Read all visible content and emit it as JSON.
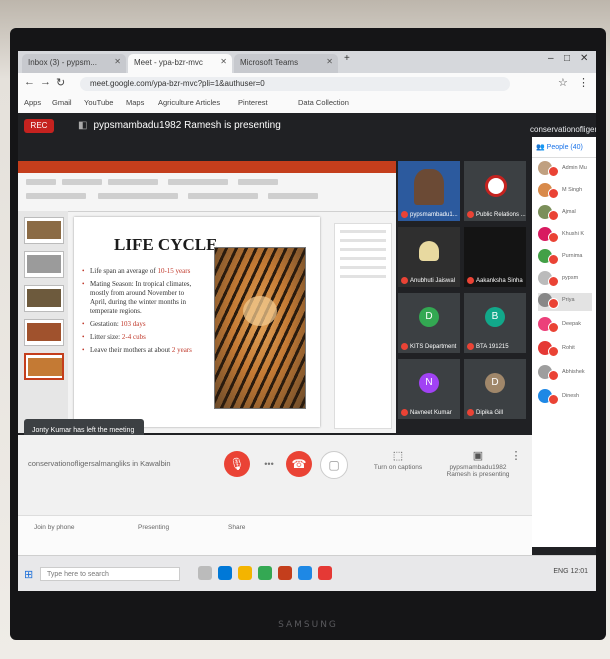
{
  "browser": {
    "tabs": [
      {
        "label": "Inbox (3) - pypsm..."
      },
      {
        "label": "Meet - ypa-bzr-mvc"
      },
      {
        "label": "Microsoft Teams"
      }
    ],
    "url": "meet.google.com/ypa-bzr-mvc?pli=1&authuser=0",
    "bookmarks": [
      "Apps",
      "Gmail",
      "YouTube",
      "Maps",
      "Agriculture Articles",
      "Pinterest",
      "Data Collection"
    ]
  },
  "meet": {
    "rec_label": "REC",
    "presenting_text": "pypsmambadu1982 Ramesh is presenting",
    "right_header": "conservationofliger",
    "people_tab": "People (40)",
    "toast": "Jonty Kumar has left the meeting",
    "meeting_code": "conservationofligersalmangliks in Kawalbin",
    "options": [
      {
        "icon": "⬚",
        "label": "Turn on captions"
      },
      {
        "icon": "▣",
        "label": "pypsmambadu1982 Ramesh is presenting"
      }
    ],
    "bottom_chips": [
      "Join by phone",
      "Presenting",
      "Share"
    ],
    "tiles": [
      {
        "label": "pypsmambadu1..."
      },
      {
        "label": "Public Relations ..."
      },
      {
        "label": "Anubhuti Jaiswal"
      },
      {
        "label": "Aakanksha Sinha"
      },
      {
        "label": "KITS Department"
      },
      {
        "label": "BTA 191215",
        "initial": "B"
      },
      {
        "label": "Navneet Kumar",
        "initial": "N"
      },
      {
        "label": "Dipika Gill",
        "initial": "D"
      }
    ],
    "people": [
      {
        "name": "Admin Mu"
      },
      {
        "name": "M Singh"
      },
      {
        "name": "Ajmal"
      },
      {
        "name": "Khushi K"
      },
      {
        "name": "Purnima"
      },
      {
        "name": "pypsm"
      },
      {
        "name": "Priya"
      },
      {
        "name": "Deepak"
      },
      {
        "name": "Rohit"
      },
      {
        "name": "Abhishek"
      },
      {
        "name": "Dinesh"
      }
    ]
  },
  "slide": {
    "title": "LIFE CYCLE",
    "bullets": [
      {
        "text": "Life span an average of ",
        "highlight": "10-15 years"
      },
      {
        "text": "Mating Season: In tropical climates, mostly from around November to April, during the winter months in temperate regions.",
        "highlight": ""
      },
      {
        "text": "Gestation: ",
        "highlight": "103 days"
      },
      {
        "text": "Litter size: ",
        "highlight": "2-4 cubs"
      },
      {
        "text": "Leave their mothers at about ",
        "highlight": "2 years"
      }
    ]
  },
  "taskbar": {
    "search_placeholder": "Type here to search",
    "tray": "ENG 12:01"
  },
  "monitor_brand": "SAMSUNG",
  "colors": {
    "record": "#c5221f",
    "end_call": "#ea4335",
    "ppt_ribbon": "#c43e1c"
  }
}
